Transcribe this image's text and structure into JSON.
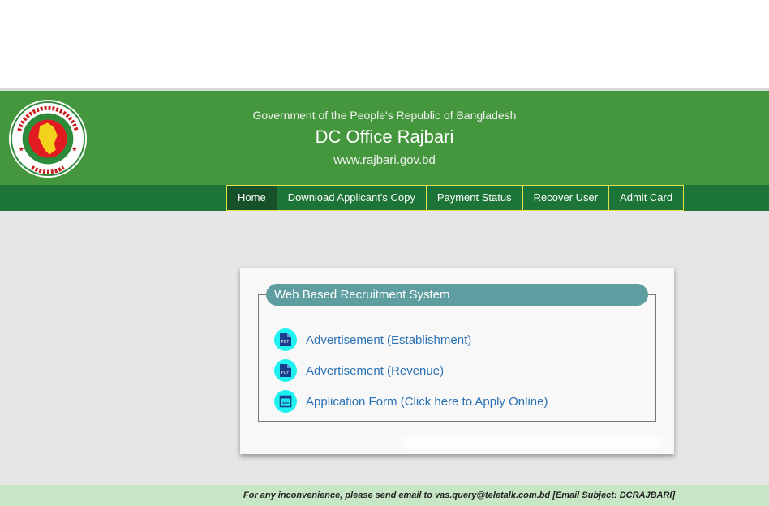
{
  "header": {
    "gov_line": "Government of the People's Republic of Bangladesh",
    "office_name": "DC Office Rajbari",
    "website": "www.rajbari.gov.bd"
  },
  "nav": {
    "items": [
      {
        "label": "Home",
        "active": true
      },
      {
        "label": "Download Applicant's Copy"
      },
      {
        "label": "Payment Status"
      },
      {
        "label": "Recover User"
      },
      {
        "label": "Admit Card"
      }
    ]
  },
  "panel": {
    "title": "Web Based Recruitment System",
    "links": [
      {
        "label": "Advertisement (Establishment)",
        "icon": "pdf-icon"
      },
      {
        "label": "Advertisement (Revenue)",
        "icon": "pdf-icon"
      },
      {
        "label": "Application Form (Click here to Apply Online)",
        "icon": "form-icon"
      }
    ]
  },
  "footer": {
    "text": "For any inconvenience, please send email to vas.query@teletalk.com.bd [Email Subject: DCRAJBARI]"
  },
  "colors": {
    "header_green": "#45973d",
    "nav_green": "#1d7437",
    "legend_teal": "#5f9ea0",
    "link_blue": "#2a72b5",
    "icon_cyan": "#1ff0f0",
    "footer_green": "#c7e6c5"
  }
}
